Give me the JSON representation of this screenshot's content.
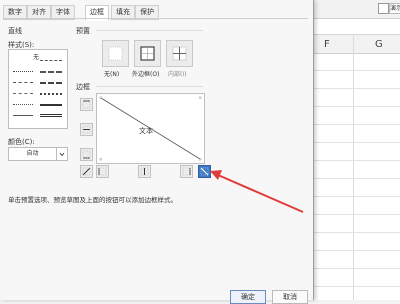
{
  "tabs": [
    {
      "label": "数字"
    },
    {
      "label": "对齐"
    },
    {
      "label": "字体"
    },
    {
      "label": "边框"
    },
    {
      "label": "填充"
    },
    {
      "label": "保护"
    }
  ],
  "line_section": {
    "title": "直线",
    "style_label": "样式(S):",
    "none_label": "无",
    "color_label": "颜色(C):",
    "color_value": "自动"
  },
  "presets": {
    "title": "预置",
    "items": [
      {
        "label": "无(N)"
      },
      {
        "label": "外边框(O)"
      },
      {
        "label": "内部(I)"
      }
    ]
  },
  "border_section": {
    "title": "边框",
    "preview_text": "文本"
  },
  "hint": "单击预置选项、预览草图及上面的按钮可以添加边框样式。",
  "buttons": {
    "ok": "确定",
    "cancel": "取消"
  },
  "sheet": {
    "columns": [
      "F",
      "G"
    ],
    "input_text": "演示"
  },
  "colors": {
    "arrow": "#e23b3b",
    "active_border_button": "#3d79c7"
  }
}
